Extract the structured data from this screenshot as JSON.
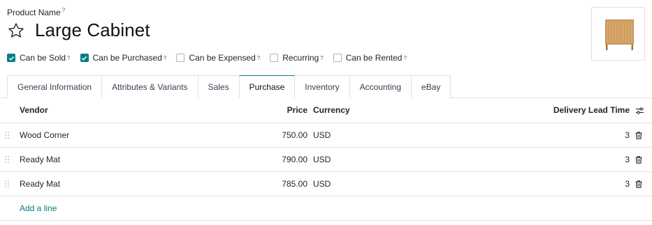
{
  "product": {
    "name_label": "Product Name",
    "help_mark": "?",
    "title": "Large Cabinet"
  },
  "checkboxes": [
    {
      "label": "Can be Sold",
      "checked": true
    },
    {
      "label": "Can be Purchased",
      "checked": true
    },
    {
      "label": "Can be Expensed",
      "checked": false
    },
    {
      "label": "Recurring",
      "checked": false
    },
    {
      "label": "Can be Rented",
      "checked": false
    }
  ],
  "tabs": [
    {
      "label": "General Information",
      "active": false
    },
    {
      "label": "Attributes & Variants",
      "active": false
    },
    {
      "label": "Sales",
      "active": false
    },
    {
      "label": "Purchase",
      "active": true
    },
    {
      "label": "Inventory",
      "active": false
    },
    {
      "label": "Accounting",
      "active": false
    },
    {
      "label": "eBay",
      "active": false
    }
  ],
  "table": {
    "headers": {
      "vendor": "Vendor",
      "price": "Price",
      "currency": "Currency",
      "lead_time": "Delivery Lead Time"
    },
    "rows": [
      {
        "vendor": "Wood Corner",
        "price": "750.00",
        "currency": "USD",
        "lead_time": "3"
      },
      {
        "vendor": "Ready Mat",
        "price": "790.00",
        "currency": "USD",
        "lead_time": "3"
      },
      {
        "vendor": "Ready Mat",
        "price": "785.00",
        "currency": "USD",
        "lead_time": "3"
      }
    ],
    "add_line": "Add a line"
  },
  "icons": {
    "favorite": "star-outline-icon",
    "optional_columns": "sliders-toggle-icon",
    "delete": "trash-icon",
    "drag": "drag-handle-icon",
    "checkbox_checked": "check-icon"
  },
  "colors": {
    "accent": "#017e84",
    "text": "#212529",
    "border": "#dee2e6"
  }
}
